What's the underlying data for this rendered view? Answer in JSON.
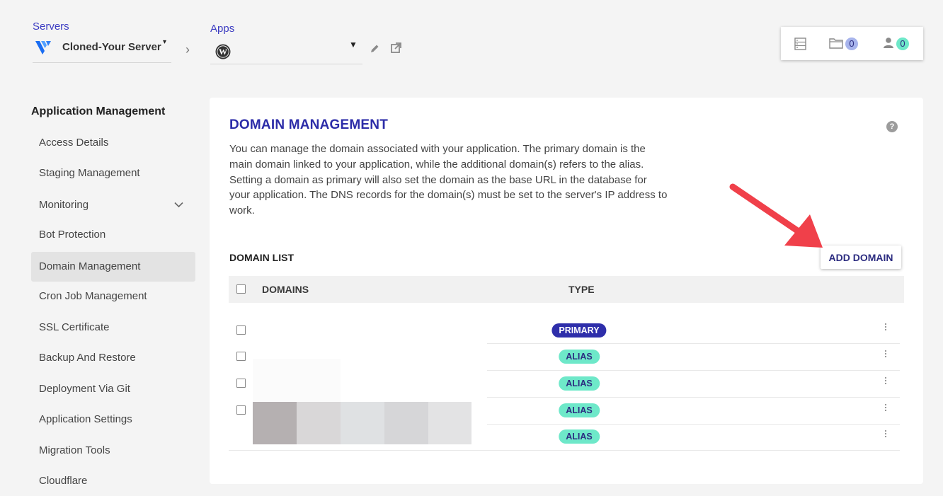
{
  "header": {
    "servers_label": "Servers",
    "server_name": "Cloned-Your Server",
    "apps_label": "Apps",
    "folder_count": "0",
    "user_count": "0"
  },
  "sidebar": {
    "title": "Application Management",
    "items": [
      {
        "label": "Access Details"
      },
      {
        "label": "Staging Management"
      },
      {
        "label": "Monitoring"
      },
      {
        "label": "Bot Protection"
      },
      {
        "label": "Domain Management"
      },
      {
        "label": "Cron Job Management"
      },
      {
        "label": "SSL Certificate"
      },
      {
        "label": "Backup And Restore"
      },
      {
        "label": "Deployment Via Git"
      },
      {
        "label": "Application Settings"
      },
      {
        "label": "Migration Tools"
      },
      {
        "label": "Cloudflare"
      }
    ]
  },
  "main": {
    "title": "DOMAIN MANAGEMENT",
    "description": "You can manage the domain associated with your application. The primary domain is the main domain linked to your application, while the additional domain(s) refers to the alias. Setting a domain as primary will also set the domain as the base URL in the database for your application. The DNS records for the domain(s) must be set to the server's IP address to work.",
    "help_icon": "?",
    "list_title": "DOMAIN LIST",
    "add_button": "ADD DOMAIN",
    "columns": {
      "domains": "DOMAINS",
      "type": "TYPE"
    },
    "rows": [
      {
        "domain": "",
        "type": "PRIMARY"
      },
      {
        "domain": "",
        "type": "ALIAS"
      },
      {
        "domain": "",
        "type": "ALIAS"
      },
      {
        "domain": "",
        "type": "ALIAS"
      },
      {
        "domain": "",
        "type": "ALIAS"
      }
    ]
  },
  "colors": {
    "accent": "#2c2ca8",
    "primary_badge": "#2e2eaa",
    "alias_badge": "#6ee8c9",
    "annotation_arrow": "#f0404a"
  },
  "icons": [
    "vultr-logo-icon",
    "wordpress-icon",
    "pencil-icon",
    "external-link-icon",
    "server-list-icon",
    "folder-icon",
    "user-icon",
    "chevron-right-icon",
    "chevron-down-icon",
    "caret-down-icon",
    "help-icon",
    "kebab-menu-icon",
    "annotation-arrow-icon"
  ]
}
